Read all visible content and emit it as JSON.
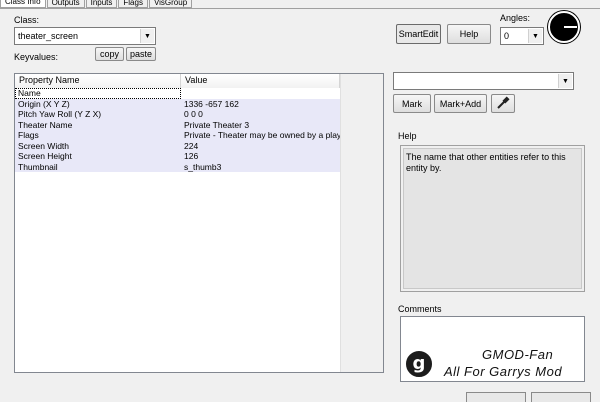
{
  "tabs": [
    "Class Info",
    "Outputs",
    "Inputs",
    "Flags",
    "VisGroup"
  ],
  "class_label": "Class:",
  "class_value": "theater_screen",
  "keyvalues_label": "Keyvalues:",
  "copy_label": "copy",
  "paste_label": "paste",
  "smartedit_label": "SmartEdit",
  "help_button_label": "Help",
  "angles_label": "Angles:",
  "angles_value": "0",
  "grid": {
    "headers": [
      "Property Name",
      "Value"
    ],
    "rows": [
      {
        "name": "Name",
        "value": ""
      },
      {
        "name": "Origin (X Y Z)",
        "value": "1336 -657 162"
      },
      {
        "name": "Pitch Yaw Roll (Y Z X)",
        "value": "0 0 0"
      },
      {
        "name": "Theater Name",
        "value": "Private Theater 3"
      },
      {
        "name": "Flags",
        "value": "Private - Theater may be owned by a play"
      },
      {
        "name": "Screen Width",
        "value": "224"
      },
      {
        "name": "Screen Height",
        "value": "126"
      },
      {
        "name": "Thumbnail",
        "value": "s_thumb3"
      }
    ]
  },
  "right_combo_value": "",
  "mark_label": "Mark",
  "markadd_label": "Mark+Add",
  "eyedropper_icon": "eyedropper-icon",
  "help_section_label": "Help",
  "help_text": "The name that other entities refer to this entity by.",
  "comments_label": "Comments",
  "watermark": {
    "logo_letter": "g",
    "line1": "GMOD-Fan",
    "line2": "All For Garrys Mod"
  }
}
